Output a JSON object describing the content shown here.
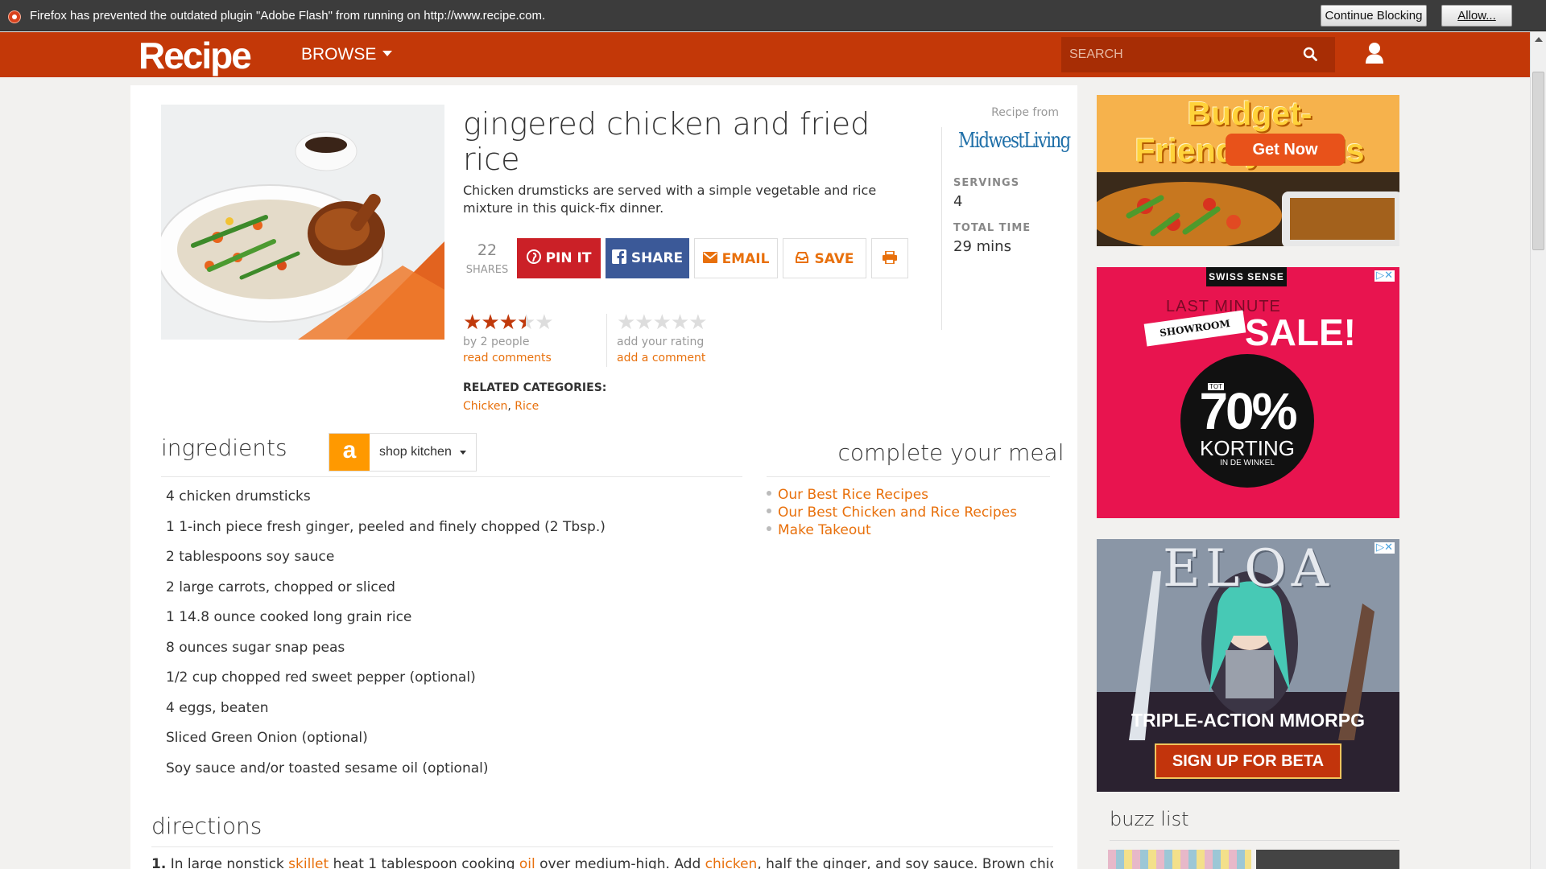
{
  "notification": {
    "message": "Firefox has prevented the outdated plugin \"Adobe Flash\" from running on http://www.recipe.com.",
    "continue_label": "Continue Blocking",
    "allow_label": "Allow..."
  },
  "header": {
    "logo": "Recipe",
    "browse_label": "BROWSE",
    "search_placeholder": "SEARCH",
    "accent_color": "#c33808"
  },
  "recipe": {
    "title": "gingered chicken and fried rice",
    "description": "Chicken drumsticks are served with a simple vegetable and rice mixture in this quick-fix dinner.",
    "share_count": "22",
    "share_label": "SHARES",
    "buttons": {
      "pin": "PIN IT",
      "share": "SHARE",
      "email": "EMAIL",
      "save": "SAVE"
    },
    "rating": {
      "average": 3.5,
      "max": 5,
      "by_text": "by 2  people",
      "read_comments": "read comments",
      "add_rating": "add your rating",
      "add_comment": "add a comment"
    },
    "related": {
      "label": "RELATED CATEGORIES:",
      "categories": [
        "Chicken",
        "Rice"
      ]
    },
    "source": {
      "label": "Recipe from",
      "brand": "MidwestLiving"
    },
    "servings_label": "SERVINGS",
    "servings": "4",
    "time_label": "TOTAL TIME",
    "time": "29 mins"
  },
  "ingredients": {
    "title": "ingredients",
    "shop_label": "shop kitchen",
    "items": [
      "4 chicken drumsticks",
      "1 1-inch piece fresh ginger, peeled and finely chopped (2 Tbsp.)",
      "2 tablespoons soy sauce",
      "2 large carrots, chopped or sliced",
      "1 14.8 ounce cooked long grain rice",
      "8 ounces sugar snap peas",
      "1/2 cup chopped red sweet pepper (optional)",
      "4 eggs, beaten",
      "Sliced Green Onion (optional)",
      "Soy sauce and/or toasted sesame oil (optional)"
    ]
  },
  "meal": {
    "title": "complete your meal",
    "links": [
      "Our Best Rice Recipes",
      "Our Best Chicken and Rice Recipes",
      "Make Takeout"
    ]
  },
  "directions": {
    "title": "directions",
    "step1": {
      "num": "1.",
      "t1": " In large nonstick ",
      "l1": "skillet",
      "t2": " heat 1 tablespoon cooking ",
      "l2": "oil",
      "t3": " over medium-high. Add ",
      "l3": "chicken",
      "t4": ", half the ginger, and soy sauce. Brown chicken"
    }
  },
  "ads": {
    "ad1": {
      "headline": "Budget-Friendly Meals",
      "cta": "Get Now"
    },
    "ad2": {
      "brand": "SWISS SENSE",
      "line1": "LAST MINUTE",
      "showroom": "SHOWROOM",
      "sale": "SALE!",
      "tot": "TOT",
      "percent": "70%",
      "korting": "KORTING",
      "winkel": "IN DE WINKEL"
    },
    "ad3": {
      "title": "ELOA",
      "tagline": "TRIPLE-ACTION MMORPG",
      "cta": "SIGN UP FOR BETA"
    }
  },
  "buzz": {
    "title": "buzz list"
  }
}
